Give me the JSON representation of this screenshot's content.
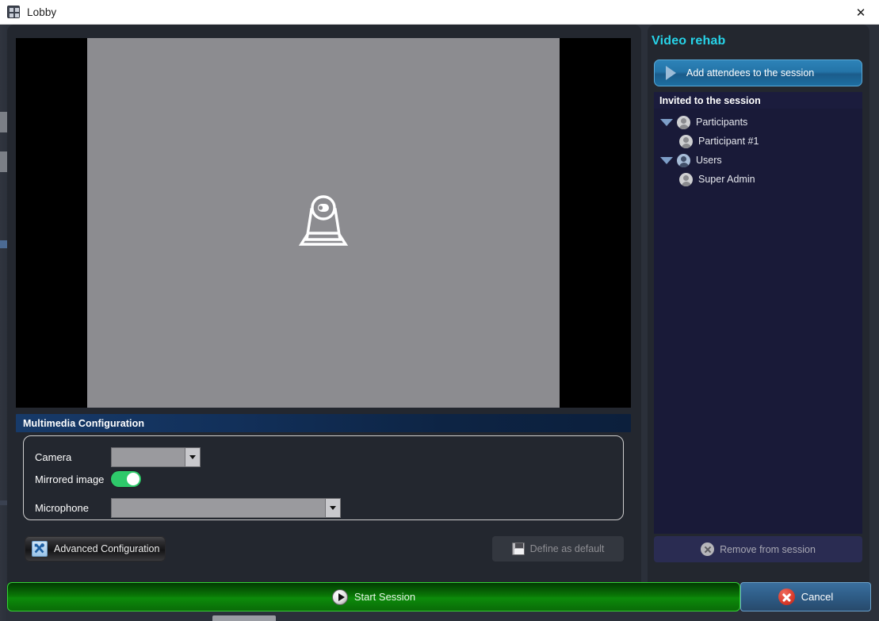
{
  "window": {
    "title": "Lobby",
    "app_icon": "app-grid-icon",
    "close_label": "✕"
  },
  "video": {
    "placeholder_icon": "laptop-webcam-icon",
    "letterbox_color": "#000000",
    "frame_color": "#8c8c90"
  },
  "multimedia": {
    "header": "Multimedia Configuration",
    "camera": {
      "label": "Camera",
      "value": "",
      "icon": "chevron-down-icon"
    },
    "mirrored": {
      "label": "Mirrored image",
      "state": "on",
      "accent": "#2ec96a"
    },
    "microphone": {
      "label": "Microphone",
      "value": "",
      "icon": "chevron-down-icon"
    },
    "advanced_button": {
      "label": "Advanced Configuration",
      "icon": "tools-icon"
    },
    "define_default_button": {
      "label": "Define as default",
      "icon": "floppy-save-icon",
      "enabled": false
    }
  },
  "right_panel": {
    "title": "Video rehab",
    "title_color": "#27d3e8",
    "add_button": {
      "label": "Add attendees to the session",
      "icon": "play-triangle-icon"
    },
    "tree_header": "Invited to the session",
    "tree": [
      {
        "label": "Participants",
        "level": 0,
        "expanded": true,
        "icon": "user-avatar-icon"
      },
      {
        "label": "Participant #1",
        "level": 1,
        "expanded": null,
        "icon": "user-avatar-icon"
      },
      {
        "label": "Users",
        "level": 0,
        "expanded": true,
        "icon": "user-avatar-blue-icon"
      },
      {
        "label": "Super Admin",
        "level": 1,
        "expanded": null,
        "icon": "user-avatar-icon"
      }
    ],
    "remove_button": {
      "label": "Remove from session",
      "icon": "circle-x-icon",
      "enabled": false
    }
  },
  "actions": {
    "start": {
      "label": "Start Session",
      "icon": "play-circle-icon",
      "color": "#0c8c0a"
    },
    "cancel": {
      "label": "Cancel",
      "icon": "circle-x-red-icon",
      "color": "#2e5c86"
    }
  }
}
